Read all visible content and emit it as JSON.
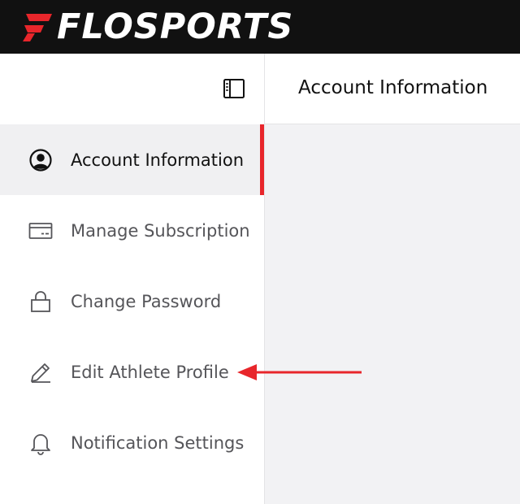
{
  "brand": {
    "name": "FLOSPORTS",
    "icon": "flosports-logo-mark",
    "accent_color": "#e8262b",
    "bar_color": "#111111"
  },
  "sidebar": {
    "collapse_icon": "sidebar-collapse-icon",
    "items": [
      {
        "label": "Account Information",
        "icon": "account-circle-icon",
        "active": true
      },
      {
        "label": "Manage Subscription",
        "icon": "credit-card-icon",
        "active": false
      },
      {
        "label": "Change Password",
        "icon": "lock-icon",
        "active": false
      },
      {
        "label": "Edit Athlete Profile",
        "icon": "pencil-icon",
        "active": false
      },
      {
        "label": "Notification Settings",
        "icon": "bell-icon",
        "active": false
      }
    ]
  },
  "main": {
    "title": "Account Information"
  },
  "annotation": {
    "icon": "red-arrow-icon",
    "color": "#e8262b"
  }
}
